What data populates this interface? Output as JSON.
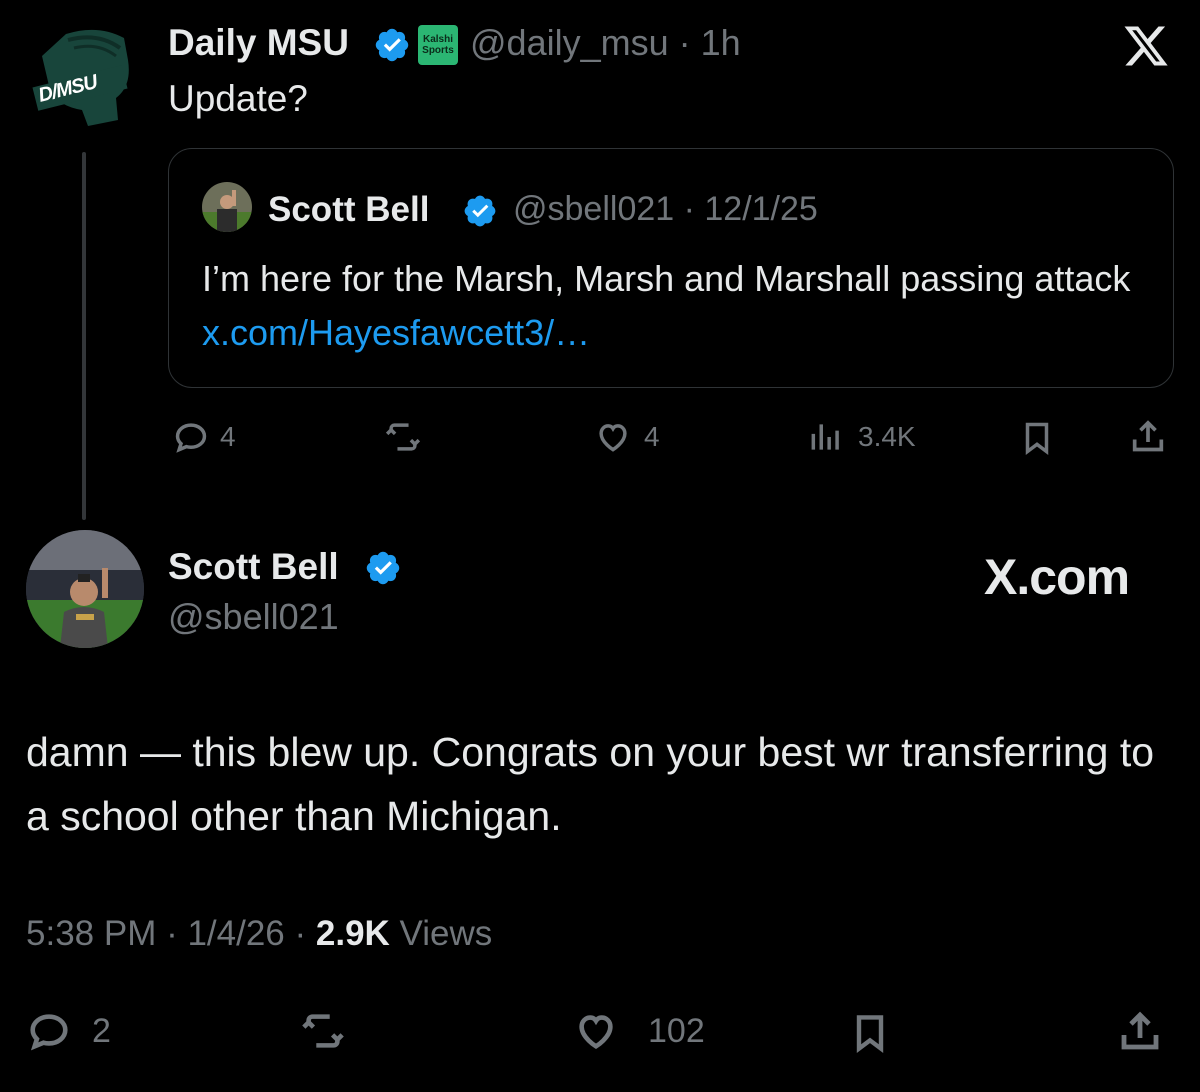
{
  "tweet_main": {
    "author_name": "Daily MSU",
    "avatar_text": "D/MSU",
    "badge_text_line1": "Kalshi",
    "badge_text_line2": "Sports",
    "handle_time": "@daily_msu · 1h",
    "text": "Update?",
    "quote": {
      "author_name": "Scott Bell",
      "handle_date": "@sbell021 · 12/1/25",
      "text": "I’m here for the Marsh, Marsh and Marshall passing attack ",
      "link": "x.com/Hayesfawcett3/…"
    },
    "actions": {
      "replies": "4",
      "likes": "4",
      "views": "3.4K"
    }
  },
  "tweet_reply": {
    "author_name": "Scott Bell",
    "handle": "@sbell021",
    "watermark": "X.com",
    "text": "damn — this blew up. Congrats on your best wr transferring to a school other than Michigan.",
    "meta_time": "5:38 PM · 1/4/26 · ",
    "meta_views_count": "2.9K",
    "meta_views_label": " Views",
    "actions": {
      "replies": "2",
      "likes": "102"
    }
  },
  "colors": {
    "background": "#000000",
    "text": "#e7e9ea",
    "secondary": "#71767b",
    "link": "#1d9bf0",
    "verified": "#1d9bf0",
    "spartan_green": "#18453b",
    "kalshi_green": "#2bb673"
  },
  "icons": [
    "verified-badge-icon",
    "x-logo-icon",
    "reply-icon",
    "retweet-icon",
    "like-icon",
    "views-icon",
    "bookmark-icon",
    "share-icon"
  ]
}
